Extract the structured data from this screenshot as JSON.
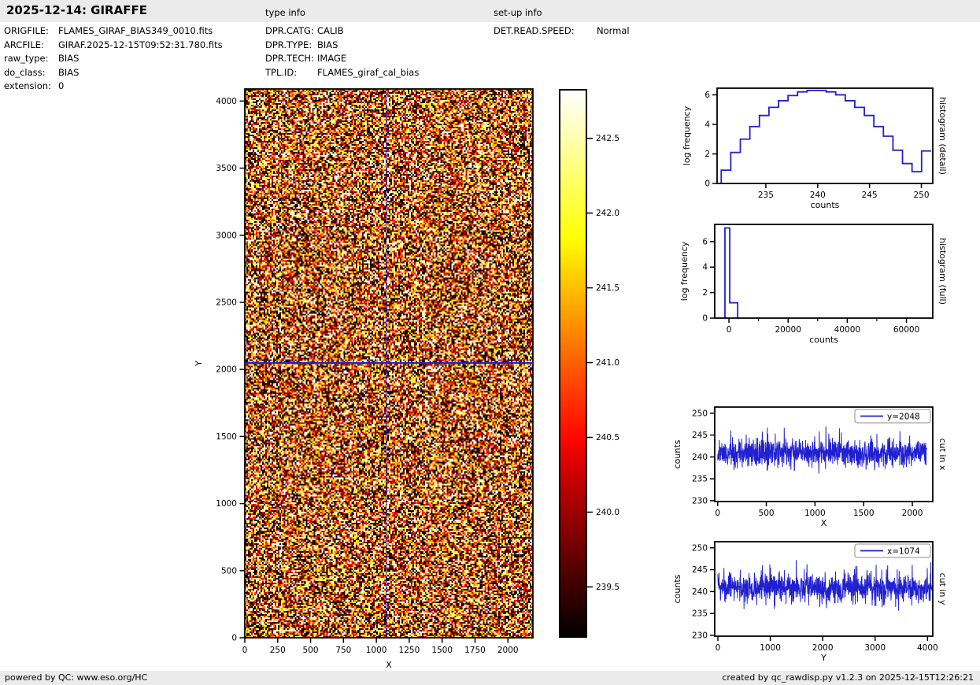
{
  "header": {
    "title": "2025-12-14: GIRAFFE",
    "type_info_label": "type info",
    "setup_info_label": "set-up info"
  },
  "file_info": {
    "rows": [
      {
        "label": "ORIGFILE:",
        "value": "FLAMES_GIRAF_BIAS349_0010.fits"
      },
      {
        "label": "ARCFILE:",
        "value": "GIRAF.2025-12-15T09:52:31.780.fits"
      },
      {
        "label": "raw_type:",
        "value": "BIAS"
      },
      {
        "label": "do_class:",
        "value": "BIAS"
      },
      {
        "label": "extension:",
        "value": "0"
      }
    ]
  },
  "type_info": {
    "rows": [
      {
        "label": "DPR.CATG:",
        "value": "CALIB"
      },
      {
        "label": "DPR.TYPE:",
        "value": "BIAS"
      },
      {
        "label": "DPR.TECH:",
        "value": "IMAGE"
      },
      {
        "label": "TPL.ID:",
        "value": "FLAMES_giraf_cal_bias"
      }
    ]
  },
  "setup_info": {
    "rows": [
      {
        "label": "DET.READ.SPEED:",
        "value": "Normal"
      }
    ]
  },
  "footer": {
    "left": "powered by QC: www.eso.org/HC",
    "right": "created by qc_rawdisp.py v1.2.3 on 2025-12-15T12:26:21"
  },
  "colors": {
    "line_blue": "#2020d0",
    "axis_black": "#000000",
    "panel_bg": "#ebebeb",
    "colormap": "hot"
  },
  "chart_data": [
    {
      "id": "main-image",
      "type": "heatmap",
      "title": "",
      "xlabel": "X",
      "ylabel": "Y",
      "xlim": [
        0,
        2190
      ],
      "ylim": [
        0,
        4090
      ],
      "x_ticks": [
        0,
        250,
        500,
        750,
        1000,
        1250,
        1500,
        1750,
        2000
      ],
      "y_ticks": [
        0,
        500,
        1000,
        1500,
        2000,
        2500,
        3000,
        3500,
        4000
      ],
      "colormap": "hot",
      "noise": {
        "mean": 240.8,
        "std": 1.8,
        "seed": 5
      },
      "crosshair": {
        "x": 1074,
        "y": 2048
      },
      "colorbar": {
        "vmin": 239.16,
        "vmax": 242.83,
        "ticks": [
          242.5,
          242.0,
          241.5,
          241.0,
          240.5,
          240.0,
          239.5
        ]
      }
    },
    {
      "id": "histogram-detail",
      "type": "step-histogram",
      "side_label": "histogram (detail)",
      "xlabel": "counts",
      "ylabel": "log frequency",
      "xlim": [
        230.3,
        251.1
      ],
      "ylim": [
        0,
        6.45
      ],
      "x_ticks": [
        235,
        240,
        245,
        250
      ],
      "y_ticks": [
        0,
        2,
        4,
        6
      ],
      "bin_start": 230.7,
      "bin_width": 0.92,
      "values": [
        0.9,
        2.1,
        3.0,
        3.85,
        4.6,
        5.15,
        5.6,
        5.95,
        6.2,
        6.3,
        6.3,
        6.2,
        6.0,
        5.6,
        5.15,
        4.6,
        3.85,
        3.2,
        2.25,
        1.35,
        0.8,
        2.2
      ]
    },
    {
      "id": "histogram-full",
      "type": "step-histogram",
      "side_label": "histogram (full)",
      "xlabel": "counts",
      "ylabel": "log frequency",
      "xlim": [
        -4800,
        68900
      ],
      "ylim": [
        0,
        7.35
      ],
      "x_ticks": [
        0,
        20000,
        40000,
        60000
      ],
      "x_minor_ticks": [
        10000,
        30000,
        50000
      ],
      "y_ticks": [
        0,
        2,
        4,
        6
      ],
      "bins": [
        {
          "x0": -1350,
          "x1": 270,
          "v": 7.07
        },
        {
          "x0": 270,
          "x1": 2950,
          "v": 1.2
        }
      ]
    },
    {
      "id": "cut-in-x",
      "type": "line",
      "side_label": "cut in x",
      "legend": "y=2048",
      "xlabel": "X",
      "ylabel": "counts",
      "xlim": [
        -30,
        2210
      ],
      "ylim": [
        229.8,
        251.4
      ],
      "x_ticks": [
        0,
        500,
        1000,
        1500,
        2000
      ],
      "y_ticks": [
        230,
        235,
        240,
        245,
        250
      ],
      "noise": {
        "n": 1100,
        "x_max": 2148,
        "mean": 241.0,
        "std": 1.55,
        "seed": 11,
        "spike_min": 235,
        "spike_max": 247
      }
    },
    {
      "id": "cut-in-y",
      "type": "line",
      "side_label": "cut in y",
      "legend": "x=1074",
      "xlabel": "Y",
      "ylabel": "counts",
      "xlim": [
        -60,
        4100
      ],
      "ylim": [
        229.8,
        251.4
      ],
      "x_ticks": [
        0,
        1000,
        2000,
        3000,
        4000
      ],
      "y_ticks": [
        230,
        235,
        240,
        245,
        250
      ],
      "noise": {
        "n": 1100,
        "x_max": 4096,
        "mean": 240.8,
        "std": 1.6,
        "seed": 23,
        "spike_min": 234,
        "spike_max": 248
      }
    }
  ]
}
